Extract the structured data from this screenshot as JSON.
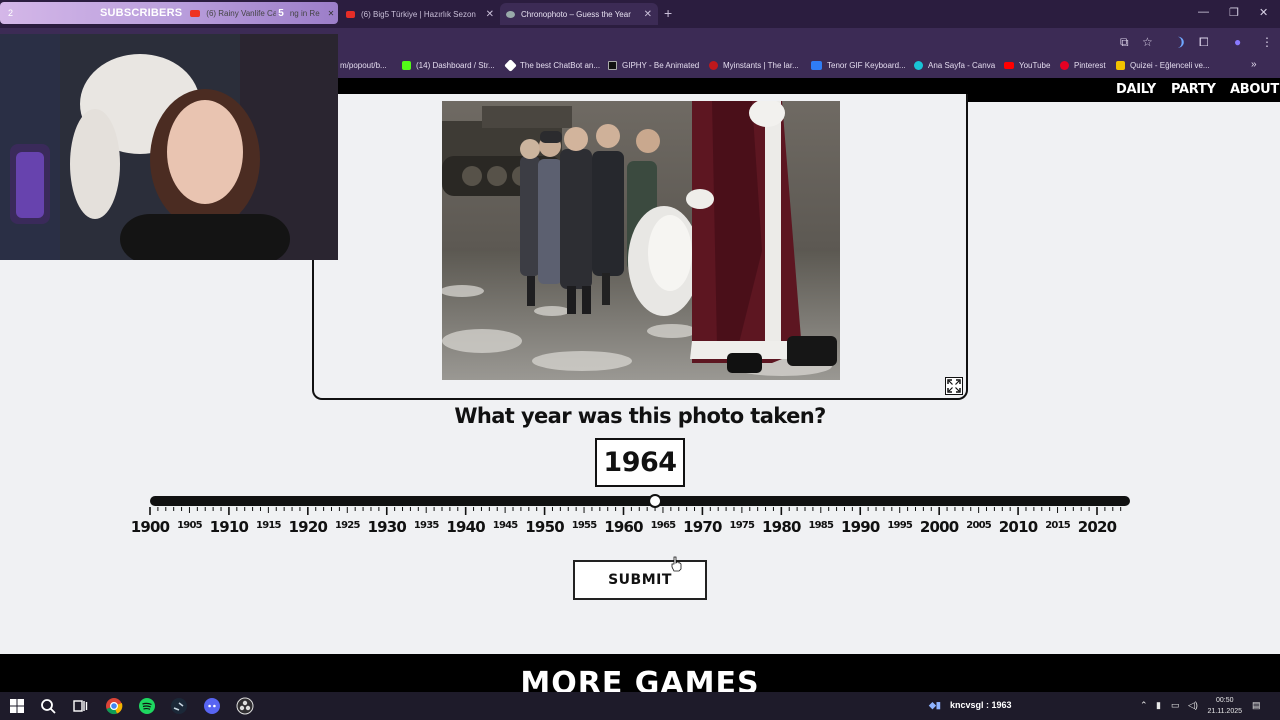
{
  "stream_overlay": {
    "counter": "2",
    "label": "SUBSCRIBERS",
    "count": "5",
    "tab_under_overlay": "(6) Rainy Vanlife Camping in Re",
    "tail": "ng in Re"
  },
  "tabs": [
    {
      "title": "(6) Big5 Türkiye | Hazırlık Sezon",
      "icon": "youtube-icon",
      "color": "#e52d27"
    },
    {
      "title": "Chronophoto – Guess the Year",
      "icon": "camera-icon",
      "color": "#9aa"
    }
  ],
  "address_partial": "m/popout/b...",
  "bookmarks": [
    {
      "label": "(14) Dashboard / Str...",
      "color": "#53fc18"
    },
    {
      "label": "The best ChatBot an...",
      "color": "#ffffff"
    },
    {
      "label": "GIPHY - Be Animated",
      "color": "#111111"
    },
    {
      "label": "Myinstants | The lar...",
      "color": "#c0181c"
    },
    {
      "label": "Tenor GIF Keyboard...",
      "color": "#2f7cf6"
    },
    {
      "label": "Ana Sayfa - Canva",
      "color": "#19c3d6"
    },
    {
      "label": "YouTube",
      "color": "#ff0000"
    },
    {
      "label": "Pinterest",
      "color": "#e60023"
    },
    {
      "label": "Quizei - Eğlenceli ve...",
      "color": "#f2c200"
    }
  ],
  "site_nav": [
    "DAILY",
    "PARTY",
    "ABOUT"
  ],
  "game": {
    "question": "What year was this photo taken?",
    "selected_year": "1964",
    "slider_min": 1900,
    "slider_max": 2024,
    "major_ticks": [
      "1900",
      "1910",
      "1920",
      "1930",
      "1940",
      "1950",
      "1960",
      "1970",
      "1980",
      "1990",
      "2000",
      "2010",
      "2020"
    ],
    "minor_ticks": [
      "1905",
      "1915",
      "1925",
      "1935",
      "1945",
      "1955",
      "1965",
      "1975",
      "1985",
      "1995",
      "2005",
      "2015"
    ],
    "submit_label": "SUBMIT",
    "more_games": "MORE GAMES"
  },
  "taskbar": {
    "chat_label": "kncvsgl : 1963",
    "time": "00:50",
    "date": "21.11.2025"
  }
}
